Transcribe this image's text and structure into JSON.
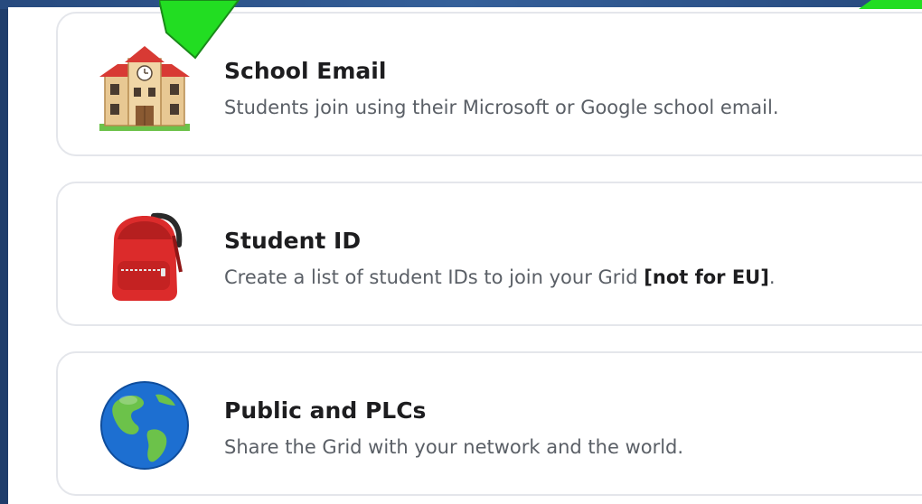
{
  "options": [
    {
      "title": "School Email",
      "description": "Students join using their Microsoft or Google school email.",
      "icon": "school-building-icon"
    },
    {
      "title": "Student ID",
      "description_before": "Create a list of student IDs to join your Grid ",
      "description_bold": "[not for EU]",
      "description_after": ".",
      "icon": "backpack-icon"
    },
    {
      "title": "Public and PLCs",
      "description": "Share the Grid with your network and the world.",
      "icon": "globe-icon"
    }
  ],
  "colors": {
    "background": "#1f3d6b",
    "card_border": "#e4e6eb",
    "title": "#1d1d1f",
    "description": "#5a5f66",
    "highlight_arrow": "#22dd22"
  }
}
